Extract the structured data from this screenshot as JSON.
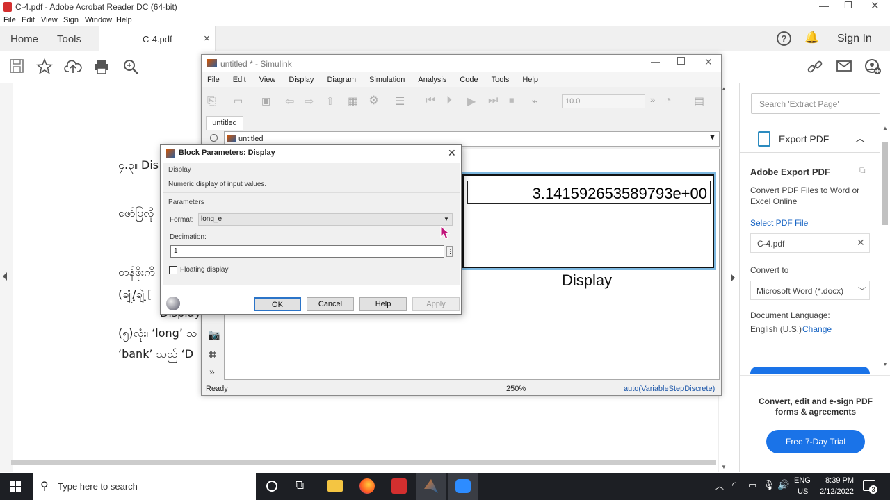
{
  "acrobat": {
    "title": "C-4.pdf - Adobe Acrobat Reader DC (64-bit)",
    "menu": [
      "File",
      "Edit",
      "View",
      "Sign",
      "Window",
      "Help"
    ],
    "tabs": {
      "home": "Home",
      "tools": "Tools",
      "doc": "C-4.pdf",
      "close": "×"
    },
    "signin": "Sign In",
    "right_pane": {
      "search_placeholder": "Search 'Extract Page'",
      "export_pdf": "Export PDF",
      "adobe_export_pdf": "Adobe Export PDF",
      "convert_desc": "Convert PDF Files to Word or Excel Online",
      "select_pdf": "Select PDF File",
      "file": "C-4.pdf",
      "convert_to": "Convert to",
      "convert_option": "Microsoft Word (*.docx)",
      "doc_language": "Document Language:",
      "language": "English (U.S.)",
      "change": "Change",
      "promo": "Convert, edit and e-sign PDF forms & agreements",
      "trial": "Free 7-Day Trial"
    },
    "document": {
      "line1": "၄.၃။ Dis",
      "line2": "ဖော်ပြလို",
      "line3": "တန်ဖိုးကိ",
      "line4": "(ချုံ့/ချဲ့ [",
      "line5": "Display",
      "line6": "(၅)လုံး၊ ‘long’ သ",
      "line7": "‘bank’ သည်  ‘D"
    }
  },
  "simulink": {
    "title": "untitled * - Simulink",
    "menu": [
      "File",
      "Edit",
      "View",
      "Display",
      "Diagram",
      "Simulation",
      "Analysis",
      "Code",
      "Tools",
      "Help"
    ],
    "sim_time": "10.0",
    "tab": "untitled",
    "address": "untitled",
    "display_value": "3.141592653589793e+00",
    "block_label": "Display",
    "status_ready": "Ready",
    "status_zoom": "250%",
    "status_solver": "auto(VariableStepDiscrete)"
  },
  "dialog": {
    "title": "Block Parameters: Display",
    "section": "Display",
    "description": "Numeric display of input values.",
    "parameters": "Parameters",
    "format_label": "Format:",
    "format_value": "long_e",
    "decimation_label": "Decimation:",
    "decimation_value": "1",
    "floating_label": "Floating display",
    "ok": "OK",
    "cancel": "Cancel",
    "help": "Help",
    "apply": "Apply"
  },
  "taskbar": {
    "search_placeholder": "Type here to search",
    "lang": "ENG",
    "region": "US",
    "time": "8:39 PM",
    "date": "2/12/2022",
    "notifications": "3"
  }
}
